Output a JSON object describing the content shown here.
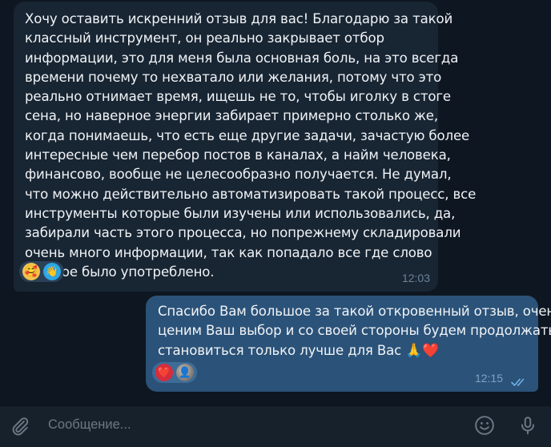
{
  "incoming_message": {
    "lines": [
      "Хочу оставить искренний отзыв для вас! Благодарю за такой",
      "классный инструмент, он реально закрывает  отбор",
      "информации, это для меня была основная боль, на это всегда",
      "времени почему то нехватало или желания, потому что это",
      "реально отнимает время, ищешь не то, чтобы иголку в стоге",
      "сена, но наверное энергии забирает примерно столько же,",
      "когда понимаешь, что есть еще другие задачи, зачастую более",
      "интересные чем перебор постов в каналах, а найм человека,",
      "финансово, вообще не целесообразно получается. Не думал,",
      "что можно действительно автоматизировать такой процесс, все",
      "инструменты которые были изучены или использовались, да,",
      "забирали часть этого процесса, но попрежнему складировали",
      "очень много информации, так как попадало все где слово",
      "нужное было употреблено."
    ],
    "reactions": [
      "🥰",
      "👋"
    ],
    "time": "12:03"
  },
  "outgoing_message": {
    "lines": [
      "Спасибо Вам большое за такой откровенный отзыв, очень",
      "ценим Ваш выбор и со своей стороны будем продолжать"
    ],
    "last_line_text": "становиться только лучше для Вас",
    "last_line_emoji": "🙏❤️",
    "reactions": [
      "❤️",
      "👤"
    ],
    "time": "12:15",
    "status": "read"
  },
  "composer": {
    "placeholder": "Сообщение..."
  },
  "icons": {
    "attach": "paperclip-icon",
    "emoji": "smiley-icon",
    "mic": "microphone-icon",
    "read_status": "double-check-icon"
  },
  "colors": {
    "background": "#0e1621",
    "incoming_bubble": "#182533",
    "outgoing_bubble": "#2b5278",
    "composer_bar": "#17212b",
    "read_checks": "#6fb2e8"
  }
}
